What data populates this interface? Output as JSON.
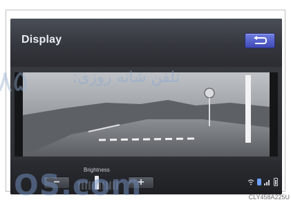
{
  "header": {
    "title": "Display"
  },
  "controls": {
    "brightness_label": "Brightness",
    "minus_label": "−",
    "plus_label": "+",
    "brightness_level": 0.45
  },
  "watermarks": {
    "persian_text": "تلفن شانه روزی:",
    "digits_text": "۸۵",
    "bottom_text": "OS.com"
  },
  "caption": "CLY458A225U"
}
